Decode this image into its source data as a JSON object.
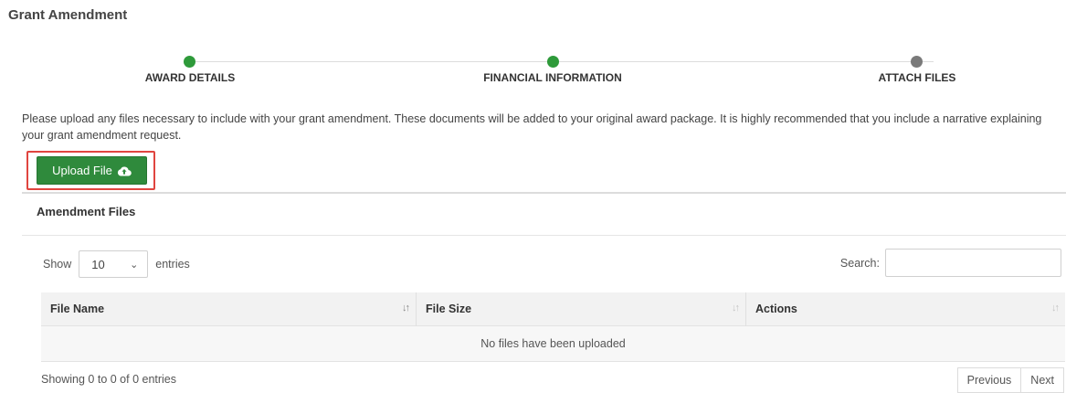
{
  "page": {
    "title": "Grant Amendment"
  },
  "stepper": {
    "steps": [
      {
        "label": "AWARD DETAILS",
        "status": "complete",
        "color": "#2e9a3a"
      },
      {
        "label": "FINANCIAL INFORMATION",
        "status": "complete",
        "color": "#2e9a3a"
      },
      {
        "label": "ATTACH FILES",
        "status": "current",
        "color": "#7a7a7a"
      }
    ]
  },
  "intro": {
    "text": "Please upload any files necessary to include with your grant amendment. These documents will be added to your original award package. It is highly recommended that you include a narrative explaining your grant amendment request."
  },
  "upload_button": {
    "label": "Upload File",
    "icon": "cloud-upload-icon",
    "color": "#2f8a3c",
    "highlight_color": "#e0453f"
  },
  "panel": {
    "title": "Amendment Files",
    "length": {
      "prefix": "Show",
      "value": "10",
      "suffix": "entries"
    },
    "search": {
      "label": "Search:",
      "placeholder": ""
    },
    "columns": [
      {
        "label": "File Name",
        "sort": "ascending"
      },
      {
        "label": "File Size",
        "sort": "none"
      },
      {
        "label": "Actions",
        "sort": "none"
      }
    ],
    "empty_message": "No files have been uploaded",
    "info": "Showing 0 to 0 of 0 entries",
    "pagination": {
      "previous": "Previous",
      "next": "Next"
    }
  }
}
